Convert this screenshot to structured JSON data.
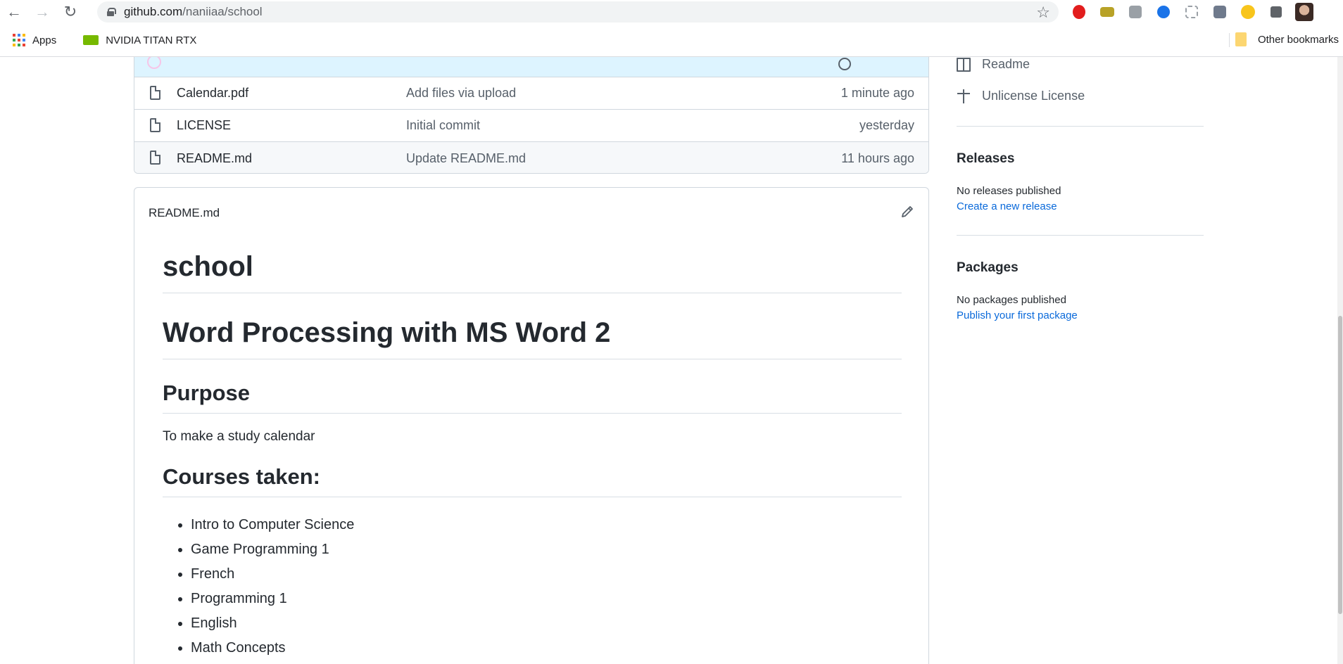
{
  "browser": {
    "url_host": "github.com",
    "url_path": "/naniiaa/school",
    "bookmarks": [
      {
        "label": "Apps"
      },
      {
        "label": "NVIDIA TITAN RTX"
      }
    ],
    "other_bookmarks": "Other bookmarks",
    "icons": [
      "back-arrow-icon",
      "forward-arrow-icon",
      "reload-icon",
      "lock-icon",
      "star-icon",
      "extensions-puzzle-icon"
    ]
  },
  "files": [
    {
      "name": "Calendar.pdf",
      "message": "Add files via upload",
      "age": "1 minute ago"
    },
    {
      "name": "LICENSE",
      "message": "Initial commit",
      "age": "yesterday"
    },
    {
      "name": "README.md",
      "message": "Update README.md",
      "age": "11 hours ago"
    }
  ],
  "readme": {
    "header": "README.md",
    "h1_title": "school",
    "h1_subtitle": "Word Processing with MS Word 2",
    "purpose_heading": "Purpose",
    "purpose_text": "To make a study calendar",
    "courses_heading": "Courses taken:",
    "courses": [
      "Intro to Computer Science",
      "Game Programming 1",
      "French",
      "Programming 1",
      "English",
      "Math Concepts"
    ]
  },
  "sidebar": {
    "readme_link": "Readme",
    "license_link": "Unlicense License",
    "releases_title": "Releases",
    "releases_text": "No releases published",
    "releases_link": "Create a new release",
    "packages_title": "Packages",
    "packages_text": "No packages published",
    "packages_link": "Publish your first package"
  },
  "colors": {
    "link": "#0969da",
    "commit_bar_bg": "#ddf4ff",
    "border": "#d0d7de"
  }
}
